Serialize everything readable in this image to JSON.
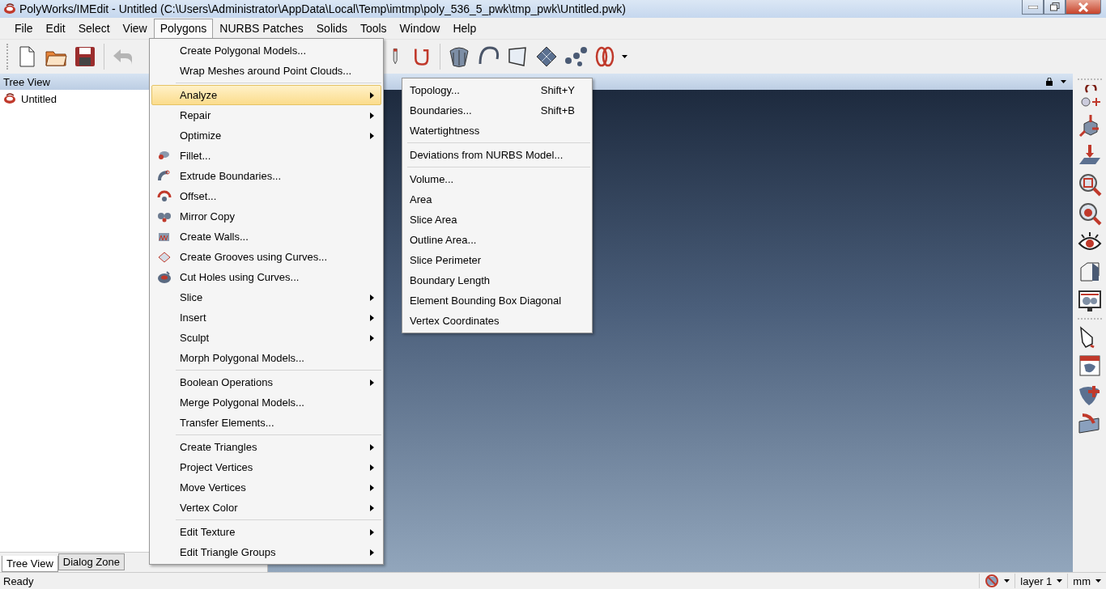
{
  "window": {
    "title": "PolyWorks/IMEdit - Untitled (C:\\Users\\Administrator\\AppData\\Local\\Temp\\imtmp\\poly_536_5_pwk\\tmp_pwk\\Untitled.pwk)"
  },
  "menubar": [
    {
      "label": "File",
      "selected": false
    },
    {
      "label": "Edit",
      "selected": false
    },
    {
      "label": "Select",
      "selected": false
    },
    {
      "label": "View",
      "selected": false
    },
    {
      "label": "Polygons",
      "selected": true
    },
    {
      "label": "NURBS Patches",
      "selected": false
    },
    {
      "label": "Solids",
      "selected": false
    },
    {
      "label": "Tools",
      "selected": false
    },
    {
      "label": "Window",
      "selected": false
    },
    {
      "label": "Help",
      "selected": false
    }
  ],
  "tree_view": {
    "title": "Tree View",
    "items": [
      {
        "label": "Untitled"
      }
    ]
  },
  "bottom_tabs": [
    {
      "label": "Tree View",
      "selected": true
    },
    {
      "label": "Dialog Zone",
      "selected": false
    }
  ],
  "polygons_menu": {
    "groups": [
      [
        {
          "label": "Create Polygonal Models...",
          "kind": "plain",
          "submenu": false,
          "selected": false
        },
        {
          "label": "Wrap Meshes around Point Clouds...",
          "kind": "plain",
          "submenu": false,
          "selected": false
        }
      ],
      [
        {
          "label": "Analyze",
          "kind": "plain",
          "submenu": true,
          "selected": true
        },
        {
          "label": "Repair",
          "kind": "plain",
          "submenu": true,
          "selected": false
        },
        {
          "label": "Optimize",
          "kind": "plain",
          "submenu": true,
          "selected": false
        },
        {
          "label": "Fillet...",
          "kind": "icon",
          "submenu": false,
          "selected": false
        },
        {
          "label": "Extrude Boundaries...",
          "kind": "icon",
          "submenu": false,
          "selected": false
        },
        {
          "label": "Offset...",
          "kind": "icon",
          "submenu": false,
          "selected": false
        },
        {
          "label": "Mirror Copy",
          "kind": "icon",
          "submenu": false,
          "selected": false
        },
        {
          "label": "Create Walls...",
          "kind": "icon",
          "submenu": false,
          "selected": false
        },
        {
          "label": "Create Grooves using Curves...",
          "kind": "icon",
          "submenu": false,
          "selected": false
        },
        {
          "label": "Cut Holes using Curves...",
          "kind": "icon",
          "submenu": false,
          "selected": false
        },
        {
          "label": "Slice",
          "kind": "plain",
          "submenu": true,
          "selected": false
        },
        {
          "label": "Insert",
          "kind": "plain",
          "submenu": true,
          "selected": false
        },
        {
          "label": "Sculpt",
          "kind": "plain",
          "submenu": true,
          "selected": false
        },
        {
          "label": "Morph Polygonal Models...",
          "kind": "plain",
          "submenu": false,
          "selected": false
        }
      ],
      [
        {
          "label": "Boolean Operations",
          "kind": "plain",
          "submenu": true,
          "selected": false
        },
        {
          "label": "Merge Polygonal Models...",
          "kind": "plain",
          "submenu": false,
          "selected": false
        },
        {
          "label": "Transfer Elements...",
          "kind": "plain",
          "submenu": false,
          "selected": false
        }
      ],
      [
        {
          "label": "Create Triangles",
          "kind": "plain",
          "submenu": true,
          "selected": false
        },
        {
          "label": "Project Vertices",
          "kind": "plain",
          "submenu": true,
          "selected": false
        },
        {
          "label": "Move Vertices",
          "kind": "plain",
          "submenu": true,
          "selected": false
        },
        {
          "label": "Vertex Color",
          "kind": "plain",
          "submenu": true,
          "selected": false
        }
      ],
      [
        {
          "label": "Edit Texture",
          "kind": "plain",
          "submenu": true,
          "selected": false
        },
        {
          "label": "Edit Triangle Groups",
          "kind": "plain",
          "submenu": true,
          "selected": false
        }
      ]
    ]
  },
  "analyze_submenu": {
    "groups": [
      [
        {
          "label": "Topology...",
          "shortcut": "Shift+Y"
        },
        {
          "label": "Boundaries...",
          "shortcut": "Shift+B"
        },
        {
          "label": "Watertightness"
        }
      ],
      [
        {
          "label": "Deviations from NURBS Model..."
        }
      ],
      [
        {
          "label": "Volume..."
        },
        {
          "label": "Area"
        },
        {
          "label": "Slice Area"
        },
        {
          "label": "Outline Area..."
        },
        {
          "label": "Slice Perimeter"
        },
        {
          "label": "Boundary Length"
        },
        {
          "label": "Element Bounding Box Diagonal"
        },
        {
          "label": "Vertex Coordinates"
        }
      ]
    ]
  },
  "status_bar": {
    "text": "Ready",
    "layer": "layer 1",
    "unit": "mm"
  }
}
